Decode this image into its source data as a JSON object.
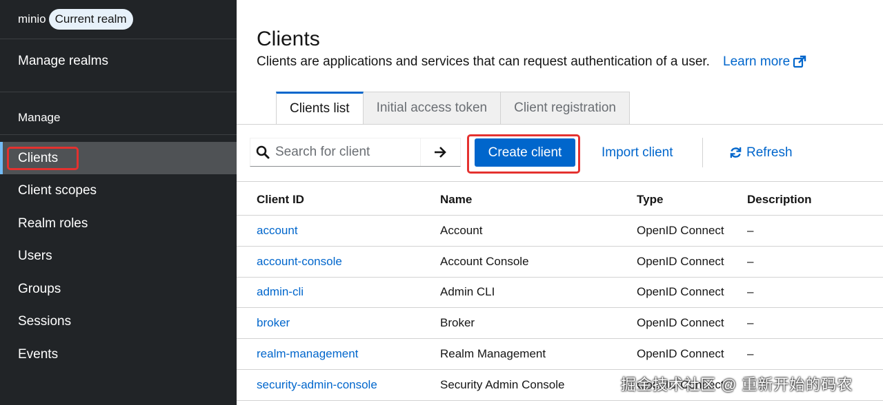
{
  "sidebar": {
    "realm_name": "minio",
    "realm_badge": "Current realm",
    "manage_realms": "Manage realms",
    "section_label": "Manage",
    "items": [
      {
        "label": "Clients"
      },
      {
        "label": "Client scopes"
      },
      {
        "label": "Realm roles"
      },
      {
        "label": "Users"
      },
      {
        "label": "Groups"
      },
      {
        "label": "Sessions"
      },
      {
        "label": "Events"
      }
    ]
  },
  "page": {
    "title": "Clients",
    "description": "Clients are applications and services that can request authentication of a user.",
    "learn_more": "Learn more",
    "learn_more_icon": "external-link-icon"
  },
  "tabs": [
    {
      "label": "Clients list",
      "active": true
    },
    {
      "label": "Initial access token",
      "active": false
    },
    {
      "label": "Client registration",
      "active": false
    }
  ],
  "toolbar": {
    "search_placeholder": "Search for client",
    "search_icon": "search-icon",
    "go_icon": "arrow-right-icon",
    "create_label": "Create client",
    "import_label": "Import client",
    "refresh_label": "Refresh",
    "refresh_icon": "refresh-icon"
  },
  "table": {
    "headers": [
      "Client ID",
      "Name",
      "Type",
      "Description"
    ],
    "rows": [
      {
        "client_id": "account",
        "name": "Account",
        "type": "OpenID Connect",
        "description": "–"
      },
      {
        "client_id": "account-console",
        "name": "Account Console",
        "type": "OpenID Connect",
        "description": "–"
      },
      {
        "client_id": "admin-cli",
        "name": "Admin CLI",
        "type": "OpenID Connect",
        "description": "–"
      },
      {
        "client_id": "broker",
        "name": "Broker",
        "type": "OpenID Connect",
        "description": "–"
      },
      {
        "client_id": "realm-management",
        "name": "Realm Management",
        "type": "OpenID Connect",
        "description": "–"
      },
      {
        "client_id": "security-admin-console",
        "name": "Security Admin Console",
        "type": "OpenID Connect",
        "description": "–"
      }
    ]
  },
  "watermark": "掘金技术社区 @ 重新开始的码农",
  "colors": {
    "sidebar_bg": "#212427",
    "accent": "#0066cc",
    "highlight": "#e4312f"
  }
}
